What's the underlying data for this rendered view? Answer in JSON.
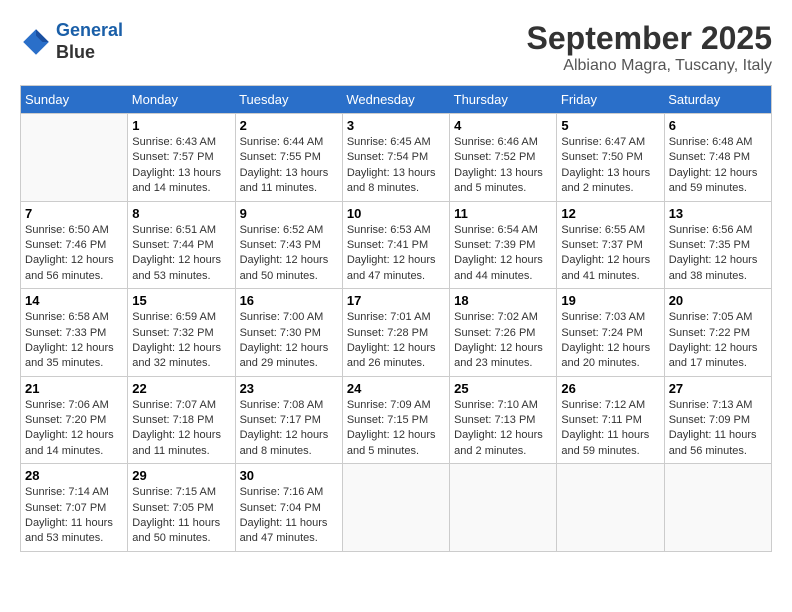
{
  "header": {
    "logo_line1": "General",
    "logo_line2": "Blue",
    "month": "September 2025",
    "location": "Albiano Magra, Tuscany, Italy"
  },
  "weekdays": [
    "Sunday",
    "Monday",
    "Tuesday",
    "Wednesday",
    "Thursday",
    "Friday",
    "Saturday"
  ],
  "weeks": [
    [
      {
        "day": "",
        "info": ""
      },
      {
        "day": "1",
        "info": "Sunrise: 6:43 AM\nSunset: 7:57 PM\nDaylight: 13 hours\nand 14 minutes."
      },
      {
        "day": "2",
        "info": "Sunrise: 6:44 AM\nSunset: 7:55 PM\nDaylight: 13 hours\nand 11 minutes."
      },
      {
        "day": "3",
        "info": "Sunrise: 6:45 AM\nSunset: 7:54 PM\nDaylight: 13 hours\nand 8 minutes."
      },
      {
        "day": "4",
        "info": "Sunrise: 6:46 AM\nSunset: 7:52 PM\nDaylight: 13 hours\nand 5 minutes."
      },
      {
        "day": "5",
        "info": "Sunrise: 6:47 AM\nSunset: 7:50 PM\nDaylight: 13 hours\nand 2 minutes."
      },
      {
        "day": "6",
        "info": "Sunrise: 6:48 AM\nSunset: 7:48 PM\nDaylight: 12 hours\nand 59 minutes."
      }
    ],
    [
      {
        "day": "7",
        "info": "Sunrise: 6:50 AM\nSunset: 7:46 PM\nDaylight: 12 hours\nand 56 minutes."
      },
      {
        "day": "8",
        "info": "Sunrise: 6:51 AM\nSunset: 7:44 PM\nDaylight: 12 hours\nand 53 minutes."
      },
      {
        "day": "9",
        "info": "Sunrise: 6:52 AM\nSunset: 7:43 PM\nDaylight: 12 hours\nand 50 minutes."
      },
      {
        "day": "10",
        "info": "Sunrise: 6:53 AM\nSunset: 7:41 PM\nDaylight: 12 hours\nand 47 minutes."
      },
      {
        "day": "11",
        "info": "Sunrise: 6:54 AM\nSunset: 7:39 PM\nDaylight: 12 hours\nand 44 minutes."
      },
      {
        "day": "12",
        "info": "Sunrise: 6:55 AM\nSunset: 7:37 PM\nDaylight: 12 hours\nand 41 minutes."
      },
      {
        "day": "13",
        "info": "Sunrise: 6:56 AM\nSunset: 7:35 PM\nDaylight: 12 hours\nand 38 minutes."
      }
    ],
    [
      {
        "day": "14",
        "info": "Sunrise: 6:58 AM\nSunset: 7:33 PM\nDaylight: 12 hours\nand 35 minutes."
      },
      {
        "day": "15",
        "info": "Sunrise: 6:59 AM\nSunset: 7:32 PM\nDaylight: 12 hours\nand 32 minutes."
      },
      {
        "day": "16",
        "info": "Sunrise: 7:00 AM\nSunset: 7:30 PM\nDaylight: 12 hours\nand 29 minutes."
      },
      {
        "day": "17",
        "info": "Sunrise: 7:01 AM\nSunset: 7:28 PM\nDaylight: 12 hours\nand 26 minutes."
      },
      {
        "day": "18",
        "info": "Sunrise: 7:02 AM\nSunset: 7:26 PM\nDaylight: 12 hours\nand 23 minutes."
      },
      {
        "day": "19",
        "info": "Sunrise: 7:03 AM\nSunset: 7:24 PM\nDaylight: 12 hours\nand 20 minutes."
      },
      {
        "day": "20",
        "info": "Sunrise: 7:05 AM\nSunset: 7:22 PM\nDaylight: 12 hours\nand 17 minutes."
      }
    ],
    [
      {
        "day": "21",
        "info": "Sunrise: 7:06 AM\nSunset: 7:20 PM\nDaylight: 12 hours\nand 14 minutes."
      },
      {
        "day": "22",
        "info": "Sunrise: 7:07 AM\nSunset: 7:18 PM\nDaylight: 12 hours\nand 11 minutes."
      },
      {
        "day": "23",
        "info": "Sunrise: 7:08 AM\nSunset: 7:17 PM\nDaylight: 12 hours\nand 8 minutes."
      },
      {
        "day": "24",
        "info": "Sunrise: 7:09 AM\nSunset: 7:15 PM\nDaylight: 12 hours\nand 5 minutes."
      },
      {
        "day": "25",
        "info": "Sunrise: 7:10 AM\nSunset: 7:13 PM\nDaylight: 12 hours\nand 2 minutes."
      },
      {
        "day": "26",
        "info": "Sunrise: 7:12 AM\nSunset: 7:11 PM\nDaylight: 11 hours\nand 59 minutes."
      },
      {
        "day": "27",
        "info": "Sunrise: 7:13 AM\nSunset: 7:09 PM\nDaylight: 11 hours\nand 56 minutes."
      }
    ],
    [
      {
        "day": "28",
        "info": "Sunrise: 7:14 AM\nSunset: 7:07 PM\nDaylight: 11 hours\nand 53 minutes."
      },
      {
        "day": "29",
        "info": "Sunrise: 7:15 AM\nSunset: 7:05 PM\nDaylight: 11 hours\nand 50 minutes."
      },
      {
        "day": "30",
        "info": "Sunrise: 7:16 AM\nSunset: 7:04 PM\nDaylight: 11 hours\nand 47 minutes."
      },
      {
        "day": "",
        "info": ""
      },
      {
        "day": "",
        "info": ""
      },
      {
        "day": "",
        "info": ""
      },
      {
        "day": "",
        "info": ""
      }
    ]
  ]
}
